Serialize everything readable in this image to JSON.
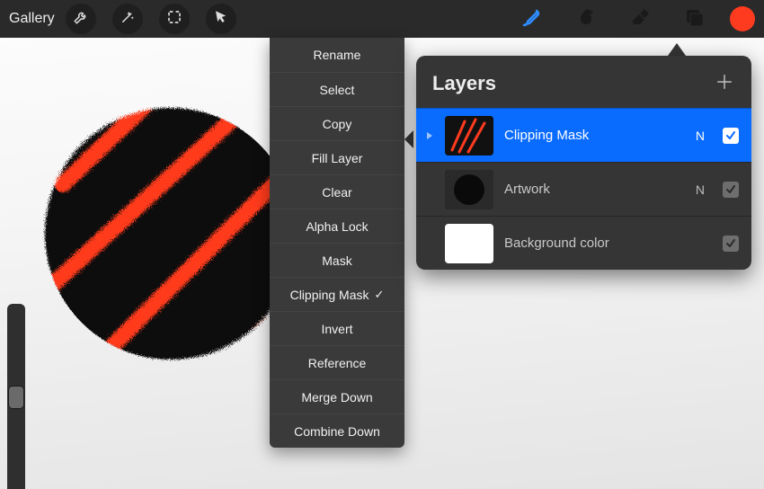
{
  "toolbar": {
    "gallery_label": "Gallery",
    "brush_color": "#2f8cff",
    "swatch_color": "#ff3b1f"
  },
  "context_menu": {
    "items": [
      {
        "label": "Rename",
        "checked": false
      },
      {
        "label": "Select",
        "checked": false
      },
      {
        "label": "Copy",
        "checked": false
      },
      {
        "label": "Fill Layer",
        "checked": false
      },
      {
        "label": "Clear",
        "checked": false
      },
      {
        "label": "Alpha Lock",
        "checked": false
      },
      {
        "label": "Mask",
        "checked": false
      },
      {
        "label": "Clipping Mask",
        "checked": true
      },
      {
        "label": "Invert",
        "checked": false
      },
      {
        "label": "Reference",
        "checked": false
      },
      {
        "label": "Merge Down",
        "checked": false
      },
      {
        "label": "Combine Down",
        "checked": false
      }
    ]
  },
  "layers_panel": {
    "title": "Layers",
    "layers": [
      {
        "name": "Clipping Mask",
        "blend": "N",
        "visible": true,
        "selected": true,
        "clip": true,
        "thumb": "red-scribble"
      },
      {
        "name": "Artwork",
        "blend": "N",
        "visible": true,
        "selected": false,
        "clip": false,
        "thumb": "black-blob"
      },
      {
        "name": "Background color",
        "blend": "",
        "visible": true,
        "selected": false,
        "clip": false,
        "thumb": "white"
      }
    ]
  },
  "colors": {
    "selection_blue": "#0a6cff",
    "stripe_red": "#ff3b1f"
  }
}
